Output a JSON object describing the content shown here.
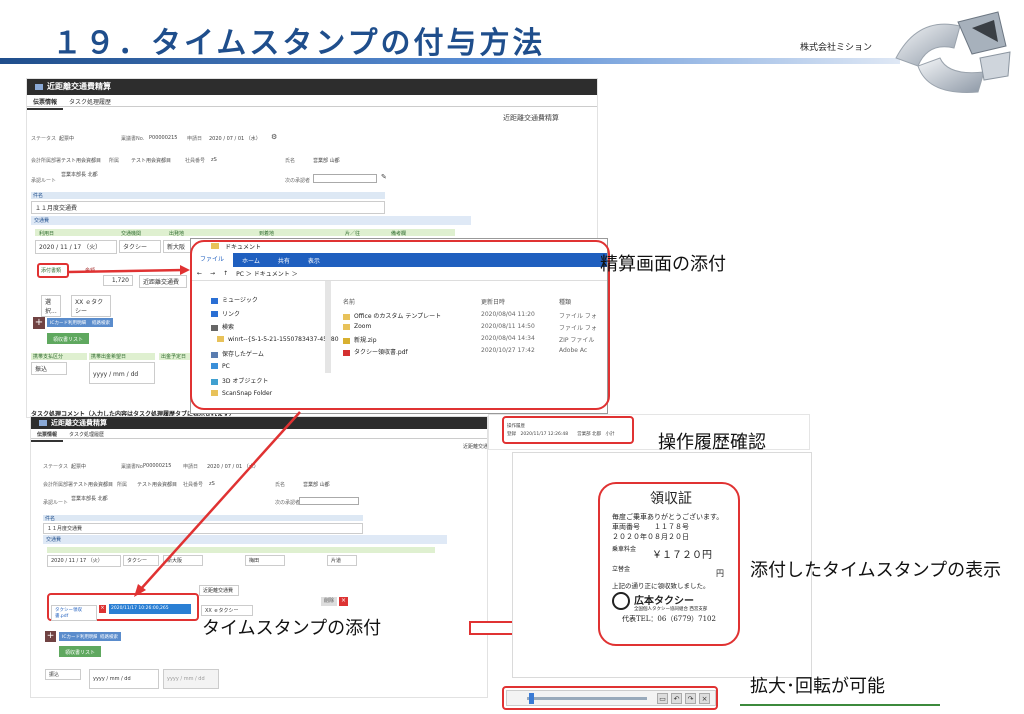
{
  "slide": {
    "title": "１９．タイムスタンプの付与方法",
    "company": "株式会社ミション"
  },
  "screen1": {
    "app_title": "近距離交通費精算",
    "tabs": [
      "伝票情報",
      "タスク処理履歴"
    ],
    "form_heading": "近距離交通費精算",
    "status_label": "ステータス",
    "status_value": "起票中",
    "slip_no_label": "稟議書No.",
    "slip_no_value": "P00000215",
    "apply_date_label": "申請日",
    "apply_date_value": "2020 / 07 / 01 （水）",
    "dept_label": "会計所属部署",
    "dept_value": "テスト用会資都目",
    "affil_label": "所属",
    "affil_value": "テスト用会資都目",
    "staff_no_label": "社員番号",
    "staff_no_value": "zS",
    "name_label": "氏名",
    "name_value": "営業部 山都",
    "route_label": "承認ルート",
    "route_value": "営業本部長 北都",
    "next_approver_label": "次の承認者",
    "subject_label": "件名",
    "subject_value": "１１月度交通費",
    "transport_section": "交通費",
    "col_date": "利用日",
    "col_type": "交通機関",
    "col_from": "出発地",
    "col_to": "到着地",
    "col_oneway": "片／往",
    "col_note": "備考欄",
    "date_value": "2020 / 11 / 17 （火）",
    "type_value": "タクシー",
    "from_value": "新大阪",
    "amount_label": "金額",
    "amount_value": "1,720",
    "category_value": "近距離交通費",
    "attach_label": "添付書類",
    "attach_btn": "選択...",
    "vehicle_value": "XX ｅタクシー",
    "btn_add_symbol": "+",
    "btn_card": "ICカード利用明細",
    "btn_route": "経路検索",
    "btn_green": "領収書リスト",
    "pay_section": "携帯支払区分",
    "pay_value": "振込",
    "payday_label": "携帯出金希望日",
    "payday_placeholder": "yyyy / mm / dd",
    "plan_label": "出金予定日",
    "comment_label": "タスク処理コメント（入力した内容はタスク処理履歴タブに表示されます）"
  },
  "explorer": {
    "path_title": "ドキュメント",
    "ribbon_tabs": [
      "ファイル",
      "ホーム",
      "共有",
      "表示"
    ],
    "address": "PC ＞ ドキュメント ＞",
    "nav_items": [
      {
        "icon": "music-icon",
        "label": "ミュージック"
      },
      {
        "icon": "link-icon",
        "label": "リンク"
      },
      {
        "icon": "search-icon",
        "label": "検索"
      },
      {
        "icon": "folder-icon",
        "label": "winrt--{S-1-5-21-1550783437-45380"
      },
      {
        "icon": "game-icon",
        "label": "保存したゲーム"
      },
      {
        "icon": "pc-icon",
        "label": "PC"
      },
      {
        "icon": "cube-icon",
        "label": "3D オブジェクト"
      },
      {
        "icon": "folder-icon",
        "label": "ScanSnap Folder"
      }
    ],
    "columns": [
      "名前",
      "更新日時",
      "種類"
    ],
    "files": [
      {
        "icon": "folder-icon",
        "name": "Office のカスタム テンプレート",
        "date": "2020/08/04 11:20",
        "kind": "ファイル フォ"
      },
      {
        "icon": "folder-icon",
        "name": "Zoom",
        "date": "2020/08/11 14:50",
        "kind": "ファイル フォ"
      },
      {
        "icon": "zip-icon",
        "name": "新規.zip",
        "date": "2020/08/04 14:34",
        "kind": "ZIP ファイル"
      },
      {
        "icon": "pdf-icon",
        "name": "タクシー領収書.pdf",
        "date": "2020/10/27 17:42",
        "kind": "Adobe Ac"
      }
    ]
  },
  "screen2": {
    "app_title": "近距離交通費精算",
    "timestamp_file": "タクシー領収書.pdf",
    "timestamp_value": "2020/11/17 10:26:00,265",
    "transport_section": "交通費",
    "date_value": "2020 / 11 / 17 （火）",
    "type_value": "タクシー",
    "from_value": "新大阪",
    "to_value": "梅田",
    "oneway_value": "片道",
    "category_value": "近距離交通費",
    "vehicle_value": "XX ｅタクシー",
    "btn_delete": "削除",
    "btn_close": "×"
  },
  "history": {
    "label": "操作履歴",
    "row": "登録　2020/11/17 12:26:48　　営業部 北都　小計"
  },
  "receipt": {
    "title": "領収証",
    "line1": "毎度ご乗車ありがとうございます。",
    "car_no": "車両番号　　１１７８号",
    "date": "２０２０年０８月２０日",
    "fare_label": "乗車料金",
    "fare_value": "￥１７２０円",
    "tate_label": "立替金",
    "tate_value": "円",
    "note": "上記の通り正に領収致しました。",
    "company": "広本タクシー",
    "company_sub": "全国個人タクシー協同組合 西宮支部",
    "phone": "代表TEL：06（6779）7102"
  },
  "callouts": {
    "attach_screen": "精算画面の添付",
    "history_check": "操作履歴確認",
    "timestamp_display": "添付したタイムスタンプの表示",
    "timestamp_attach": "タイムスタンプの添付",
    "zoom_rotate": "拡大･回転が可能"
  },
  "colors": {
    "title": "#1f4e8c",
    "highlight": "#e03232",
    "arrow": "#e03232"
  }
}
